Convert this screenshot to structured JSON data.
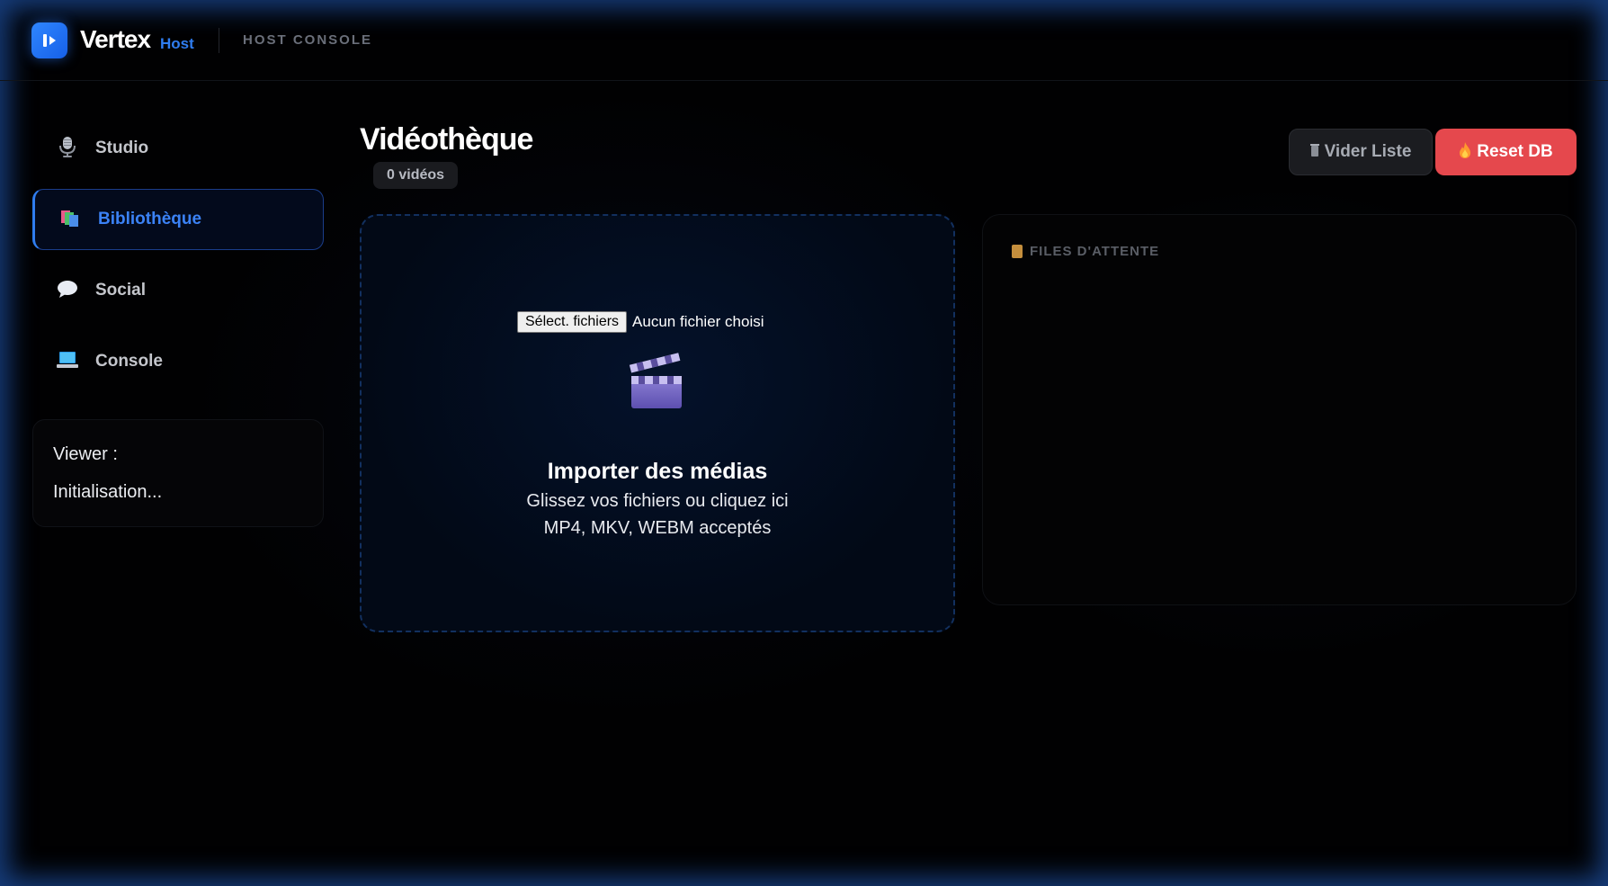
{
  "header": {
    "brand": "Vertex",
    "brand_sub": "Host",
    "console_label": "HOST CONSOLE",
    "logo_icon": "play-logo-icon",
    "accent_color": "#2f7df0"
  },
  "sidebar": {
    "items": [
      {
        "label": "Studio",
        "icon": "microphone-icon",
        "active": false
      },
      {
        "label": "Bibliothèque",
        "icon": "books-icon",
        "active": true
      },
      {
        "label": "Social",
        "icon": "speech-bubble-icon",
        "active": false
      },
      {
        "label": "Console",
        "icon": "laptop-icon",
        "active": false
      }
    ],
    "viewer": {
      "label": "Viewer :",
      "status": "Initialisation..."
    }
  },
  "main": {
    "title": "Vidéothèque",
    "count": "0 vidéos",
    "clear_button": "Vider Liste",
    "reset_button": "Reset DB",
    "reset_color": "#e5484d",
    "dropzone": {
      "file_button": "Sélect. fichiers",
      "file_status": "Aucun fichier choisi",
      "icon": "clapperboard-icon",
      "title": "Importer des médias",
      "hint": "Glissez vos fichiers ou cliquez ici",
      "formats": "MP4, MKV, WEBM acceptés"
    },
    "queue": {
      "title": "FILES D'ATTENTE",
      "icon": "scroll-icon"
    }
  }
}
